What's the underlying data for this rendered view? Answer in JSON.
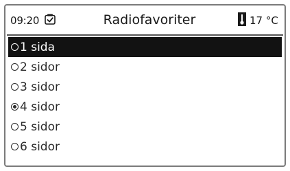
{
  "header": {
    "time": "09:20",
    "clock_icon": "clock-check-icon",
    "title": "Radiofavoriter",
    "thermometer_icon": "thermometer-icon",
    "temperature": "17 °C"
  },
  "list": {
    "items": [
      {
        "label": "1 sida",
        "selected": true,
        "checked": false
      },
      {
        "label": "2 sidor",
        "selected": false,
        "checked": false
      },
      {
        "label": "3 sidor",
        "selected": false,
        "checked": false
      },
      {
        "label": "4 sidor",
        "selected": false,
        "checked": true
      },
      {
        "label": "5 sidor",
        "selected": false,
        "checked": false
      },
      {
        "label": "6 sidor",
        "selected": false,
        "checked": false
      }
    ]
  },
  "colors": {
    "selection_bg": "#121212",
    "selection_text": "#ffffff",
    "text": "#2a2a2a",
    "border": "#7a7a7a"
  }
}
